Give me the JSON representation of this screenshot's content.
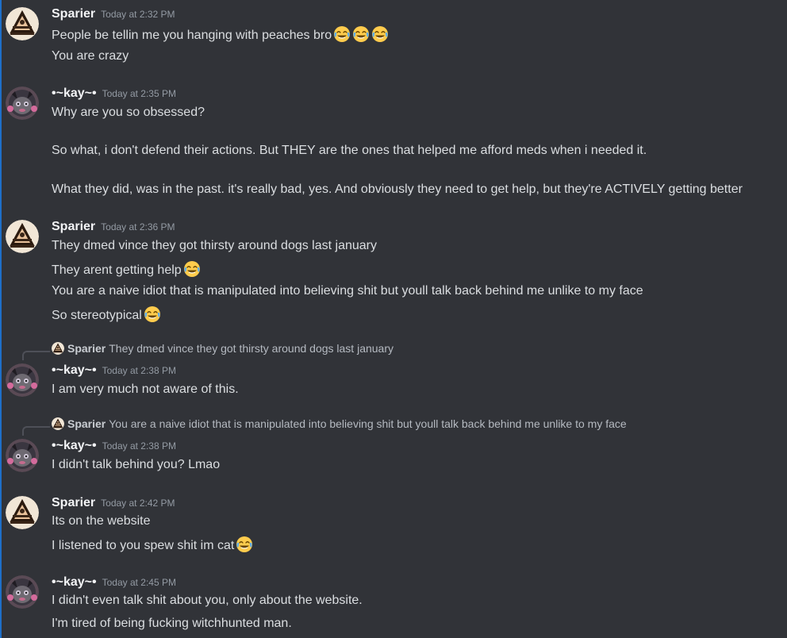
{
  "messages": [
    {
      "author": "Sparier",
      "timestamp": "Today at 2:32 PM",
      "avatar": "sparier-avatar",
      "lines": [
        {
          "text": "People be tellin me you hanging with peaches bro",
          "emoji": [
            "joy",
            "joy",
            "joy"
          ]
        },
        {
          "text": "You are crazy"
        }
      ]
    },
    {
      "author": "•~kay~•",
      "timestamp": "Today at 2:35 PM",
      "avatar": "kay-avatar",
      "lines": [
        {
          "text": "Why are you so obsessed?"
        },
        {
          "text": "So what, i don't defend their actions. But THEY are the ones that helped me afford meds when i needed it."
        },
        {
          "text": "What they did, was in the past. it's really bad, yes. And obviously they need to get help, but they're ACTIVELY getting better"
        }
      ]
    },
    {
      "author": "Sparier",
      "timestamp": "Today at 2:36 PM",
      "avatar": "sparier-avatar",
      "lines": [
        {
          "text": "They dmed vince they got thirsty around dogs last january"
        },
        {
          "text": "They arent getting help",
          "emoji": [
            "joy"
          ]
        },
        {
          "text": "You are a naive idiot that is manipulated into believing shit but youll talk back behind me unlike to my face"
        },
        {
          "text": "So stereotypical",
          "emoji": [
            "joy"
          ]
        }
      ]
    },
    {
      "reply": {
        "author": "Sparier",
        "text": "They dmed vince they got thirsty around dogs last january"
      },
      "author": "•~kay~•",
      "timestamp": "Today at 2:38 PM",
      "avatar": "kay-avatar",
      "lines": [
        {
          "text": "I am very much not aware of this."
        }
      ]
    },
    {
      "reply": {
        "author": "Sparier",
        "text": "You are a naive idiot that is manipulated into believing shit but youll talk back behind me unlike to my face"
      },
      "author": "•~kay~•",
      "timestamp": "Today at 2:38 PM",
      "avatar": "kay-avatar",
      "lines": [
        {
          "text": "I didn't talk behind you? Lmao"
        }
      ]
    },
    {
      "author": "Sparier",
      "timestamp": "Today at 2:42 PM",
      "avatar": "sparier-avatar",
      "lines": [
        {
          "text": "Its on the website"
        },
        {
          "text": "I listened to you spew shit im cat",
          "emoji": [
            "joy"
          ]
        }
      ]
    },
    {
      "author": "•~kay~•",
      "timestamp": "Today at 2:45 PM",
      "avatar": "kay-avatar",
      "lines": [
        {
          "text": "I didn't even talk shit about you, only about the website."
        },
        {
          "text": "I'm tired of being fucking witchhunted man."
        }
      ]
    }
  ],
  "colors": {
    "background": "#313338",
    "username": "#f2f3f5",
    "timestamp": "#949ba4",
    "text": "#dbdee1",
    "left_border": "#1e6fc8"
  }
}
